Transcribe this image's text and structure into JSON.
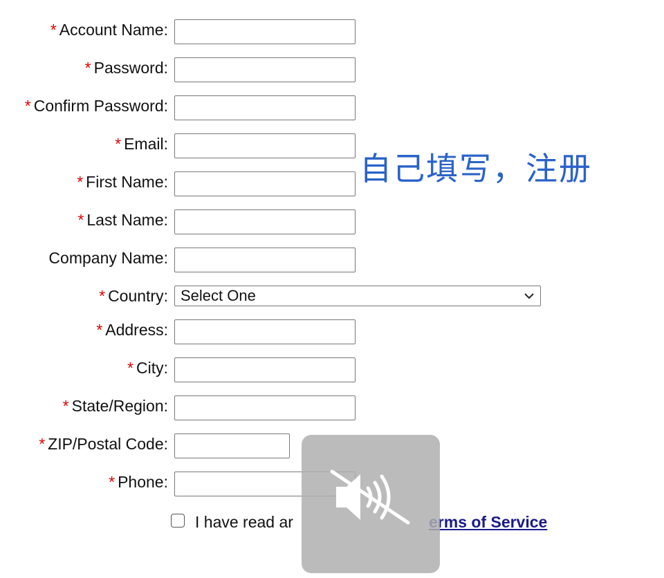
{
  "form": {
    "fields": [
      {
        "label": "Account Name:",
        "required": "*",
        "value": ""
      },
      {
        "label": "Password:",
        "required": "*",
        "value": ""
      },
      {
        "label": "Confirm Password:",
        "required": "*",
        "value": ""
      },
      {
        "label": "Email:",
        "required": "*",
        "value": ""
      },
      {
        "label": "First Name:",
        "required": "*",
        "value": ""
      },
      {
        "label": "Last Name:",
        "required": "*",
        "value": ""
      },
      {
        "label": "Company Name:",
        "required": "",
        "value": ""
      },
      {
        "label": "Country:",
        "required": "*",
        "selected": "Select One"
      },
      {
        "label": "Address:",
        "required": "*",
        "value": ""
      },
      {
        "label": "City:",
        "required": "*",
        "value": ""
      },
      {
        "label": "State/Region:",
        "required": "*",
        "value": ""
      },
      {
        "label": "ZIP/Postal Code:",
        "required": "*",
        "value": ""
      },
      {
        "label": "Phone:",
        "required": "*",
        "value": ""
      }
    ],
    "agree": {
      "text_visible": "I have read ar",
      "link": "erms of Service",
      "checked": false
    }
  },
  "annotation": {
    "text": "自己填写，注册",
    "color": "#2a62c9"
  },
  "overlay": {
    "icon": "speaker-muted-icon"
  },
  "colors": {
    "required": "#e00000",
    "link": "#1a1a8c"
  }
}
